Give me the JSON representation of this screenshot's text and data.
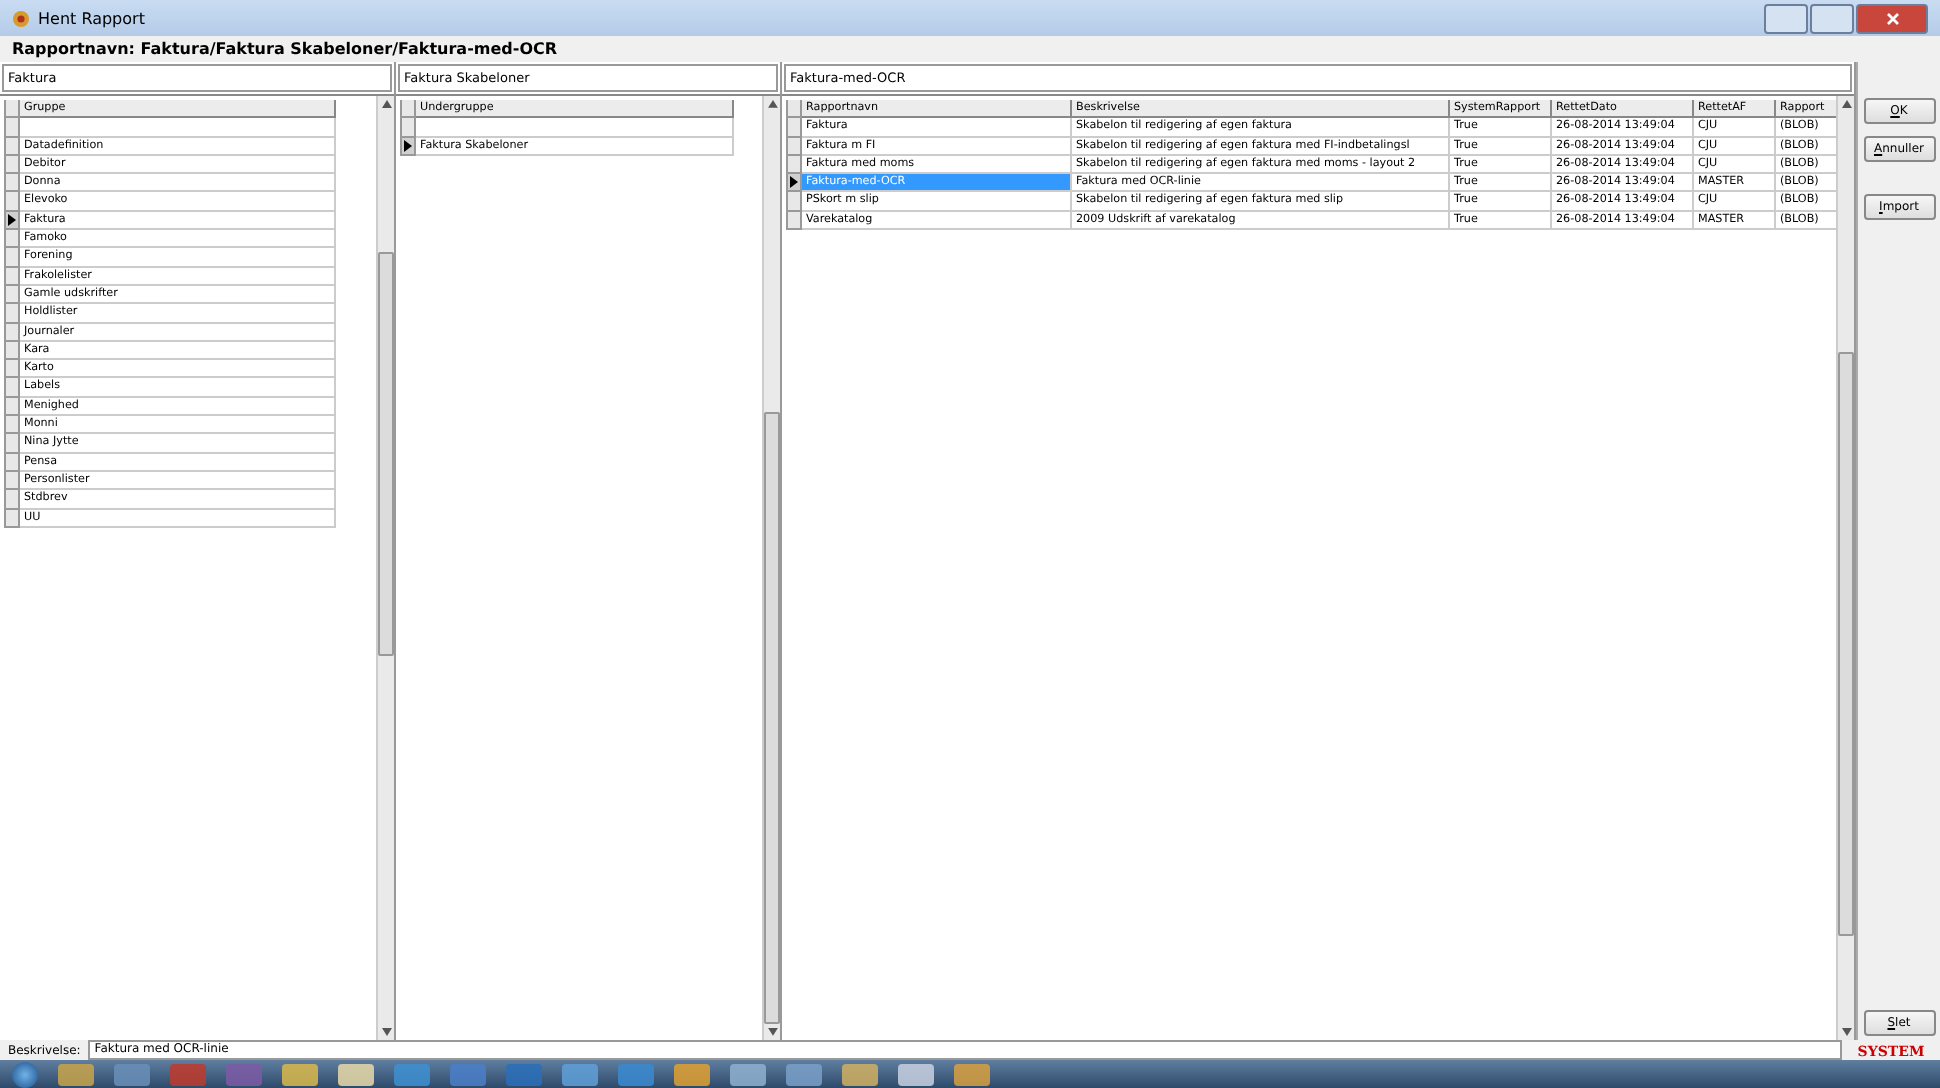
{
  "window": {
    "title": "Hent Rapport"
  },
  "caption": "Rapportnavn: Faktura/Faktura Skabeloner/Faktura-med-OCR",
  "groups": {
    "filter": "Faktura",
    "column": "Gruppe",
    "rows": [
      {
        "name": "",
        "selected": false
      },
      {
        "name": "Datadefinition",
        "selected": false
      },
      {
        "name": "Debitor",
        "selected": false
      },
      {
        "name": "Donna",
        "selected": false
      },
      {
        "name": "Elevoko",
        "selected": false
      },
      {
        "name": "Faktura",
        "selected": true
      },
      {
        "name": "Famoko",
        "selected": false
      },
      {
        "name": "Forening",
        "selected": false
      },
      {
        "name": "Frakolelister",
        "selected": false
      },
      {
        "name": "Gamle udskrifter",
        "selected": false
      },
      {
        "name": "Holdlister",
        "selected": false
      },
      {
        "name": "Journaler",
        "selected": false
      },
      {
        "name": "Kara",
        "selected": false
      },
      {
        "name": "Karto",
        "selected": false
      },
      {
        "name": "Labels",
        "selected": false
      },
      {
        "name": "Menighed",
        "selected": false
      },
      {
        "name": "Monni",
        "selected": false
      },
      {
        "name": "Nina Jytte",
        "selected": false
      },
      {
        "name": "Pensa",
        "selected": false
      },
      {
        "name": "Personlister",
        "selected": false
      },
      {
        "name": "Stdbrev",
        "selected": false
      },
      {
        "name": "UU",
        "selected": false
      }
    ]
  },
  "subgroups": {
    "filter": "Faktura Skabeloner",
    "column": "Undergruppe",
    "rows": [
      {
        "name": "",
        "selected": false
      },
      {
        "name": "Faktura Skabeloner",
        "selected": true
      }
    ]
  },
  "reports": {
    "filter": "Faktura-med-OCR",
    "columns": [
      "Rapportnavn",
      "Beskrivelse",
      "SystemRapport",
      "RettetDato",
      "RettetAF",
      "Rapport"
    ],
    "rows": [
      {
        "selected": false,
        "cells": [
          "Faktura",
          "Skabelon til redigering af egen faktura",
          "True",
          "26-08-2014 13:49:04",
          "CJU",
          "(BLOB)"
        ]
      },
      {
        "selected": false,
        "cells": [
          "Faktura m FI",
          "Skabelon til redigering af egen faktura med FI-indbetalingsl",
          "True",
          "26-08-2014 13:49:04",
          "CJU",
          "(BLOB)"
        ]
      },
      {
        "selected": false,
        "cells": [
          "Faktura med moms",
          "Skabelon til redigering af egen faktura med moms - layout 2",
          "True",
          "26-08-2014 13:49:04",
          "CJU",
          "(BLOB)"
        ]
      },
      {
        "selected": true,
        "cells": [
          "Faktura-med-OCR",
          "Faktura med OCR-linie",
          "True",
          "26-08-2014 13:49:04",
          "MASTER",
          "(BLOB)"
        ]
      },
      {
        "selected": false,
        "cells": [
          "PSkort m slip",
          "Skabelon til redigering af egen faktura med slip",
          "True",
          "26-08-2014 13:49:04",
          "CJU",
          "(BLOB)"
        ]
      },
      {
        "selected": false,
        "cells": [
          "Varekatalog",
          "2009 Udskrift af varekatalog",
          "True",
          "26-08-2014 13:49:04",
          "MASTER",
          "(BLOB)"
        ]
      }
    ]
  },
  "buttons": [
    "OK",
    "Annuller",
    "Import"
  ],
  "delete_button": "Slet",
  "description": {
    "label": "Beskrivelse:",
    "value": "Faktura med OCR-linie"
  },
  "system_label": "SYSTEM"
}
